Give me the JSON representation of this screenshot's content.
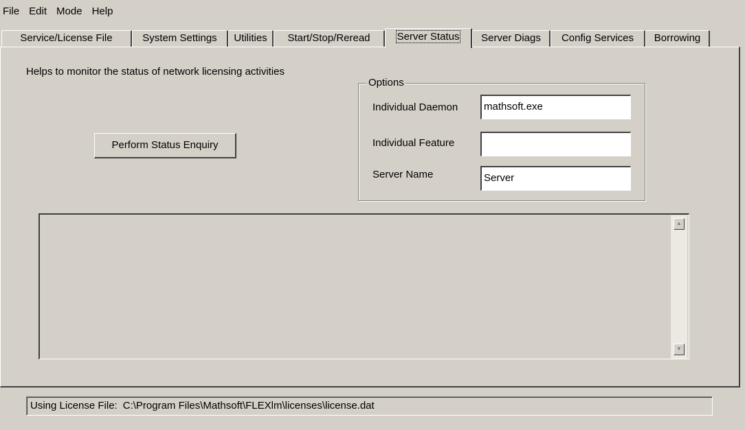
{
  "menu": [
    "File",
    "Edit",
    "Mode",
    "Help"
  ],
  "tabs": [
    {
      "label": "Service/License File",
      "active": false
    },
    {
      "label": "System Settings",
      "active": false
    },
    {
      "label": "Utilities",
      "active": false
    },
    {
      "label": "Start/Stop/Reread",
      "active": false
    },
    {
      "label": "Server Status",
      "active": true
    },
    {
      "label": "Server Diags",
      "active": false
    },
    {
      "label": "Config Services",
      "active": false
    },
    {
      "label": "Borrowing",
      "active": false
    }
  ],
  "panel": {
    "description": "Helps to monitor the status of network licensing activities",
    "perform_button": "Perform Status Enquiry",
    "options": {
      "title": "Options",
      "daemon_label": "Individual Daemon",
      "daemon_value": "mathsoft.exe",
      "feature_label": "Individual Feature",
      "feature_value": "",
      "server_label": "Server Name",
      "server_value": "Server"
    },
    "output_text": ""
  },
  "status": {
    "prefix": "Using License File:",
    "path": "C:\\Program Files\\Mathsoft\\FLEXlm\\licenses\\license.dat"
  },
  "icons": {
    "scroll_up": "scroll-up-arrow-icon",
    "scroll_down": "scroll-down-arrow-icon"
  }
}
